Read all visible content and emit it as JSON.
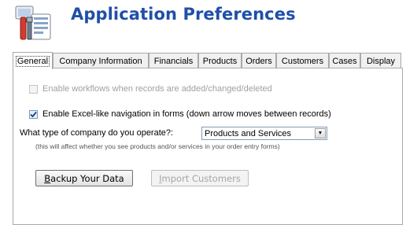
{
  "header": {
    "title": "Application Preferences",
    "icon": "preferences-tools-icon"
  },
  "tabs": [
    {
      "label": "General",
      "active": true
    },
    {
      "label": "Company Information",
      "active": false
    },
    {
      "label": "Financials",
      "active": false
    },
    {
      "label": "Products",
      "active": false
    },
    {
      "label": "Orders",
      "active": false
    },
    {
      "label": "Customers",
      "active": false
    },
    {
      "label": "Cases",
      "active": false
    },
    {
      "label": "Display",
      "active": false
    }
  ],
  "general": {
    "workflows": {
      "label": "Enable workflows when records are added/changed/deleted",
      "checked": false,
      "enabled": false
    },
    "excel_nav": {
      "label": "Enable Excel-like navigation in forms (down arrow moves between records)",
      "checked": true,
      "enabled": true
    },
    "company_type": {
      "label": "What type of company do you operate?:",
      "value": "Products and Services",
      "note": "(this will affect whether you see products and/or services in your order entry forms)"
    },
    "backup_button": {
      "accel": "B",
      "rest": "ackup Your Data",
      "enabled": true
    },
    "import_button": {
      "accel": "I",
      "rest": "mport Customers",
      "enabled": false
    }
  }
}
